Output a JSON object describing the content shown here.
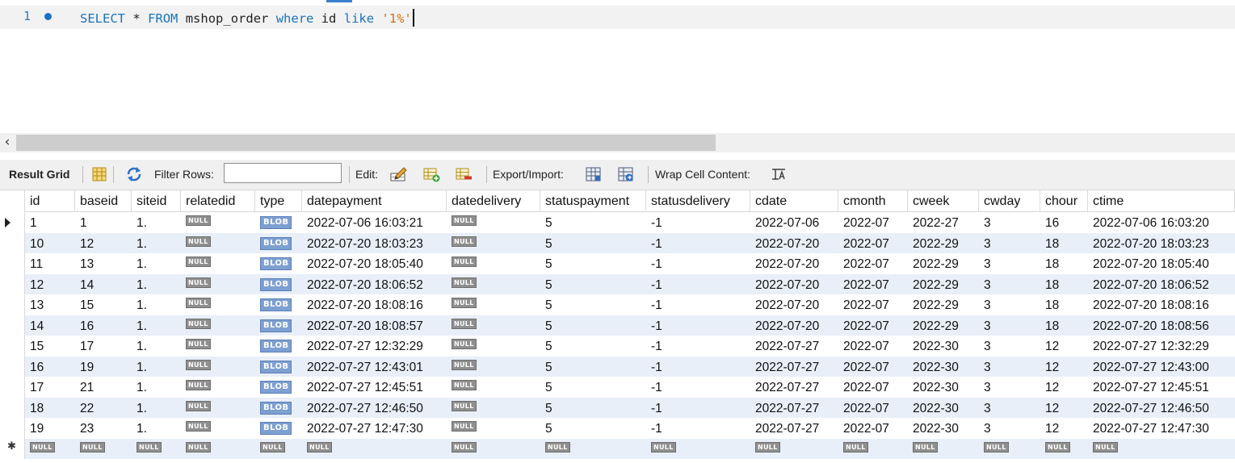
{
  "editor": {
    "line_number": "1",
    "sql": {
      "kw_select": "SELECT",
      "star": "*",
      "kw_from": "FROM",
      "table": "mshop_order",
      "kw_where": "where",
      "column": "id",
      "kw_like": "like",
      "literal": "'1%'"
    }
  },
  "toolbar": {
    "result_grid": "Result Grid",
    "filter_rows": "Filter Rows:",
    "filter_value": "",
    "edit": "Edit:",
    "export_import": "Export/Import:",
    "wrap_cell": "Wrap Cell Content:",
    "icons": [
      "grid-layout-icon",
      "refresh-icon",
      "edit-row-icon",
      "add-row-icon",
      "delete-row-icon",
      "export-icon",
      "import-icon",
      "wrap-text-icon"
    ]
  },
  "grid": {
    "columns": [
      "id",
      "baseid",
      "siteid",
      "relatedid",
      "type",
      "datepayment",
      "datedelivery",
      "statuspayment",
      "statusdelivery",
      "cdate",
      "cmonth",
      "cweek",
      "cwday",
      "chour",
      "ctime"
    ],
    "rows": [
      [
        "1",
        "1",
        "1.",
        "NULL",
        "BLOB",
        "2022-07-06 16:03:21",
        "NULL",
        "5",
        "-1",
        "2022-07-06",
        "2022-07",
        "2022-27",
        "3",
        "16",
        "2022-07-06 16:03:20"
      ],
      [
        "10",
        "12",
        "1.",
        "NULL",
        "BLOB",
        "2022-07-20 18:03:23",
        "NULL",
        "5",
        "-1",
        "2022-07-20",
        "2022-07",
        "2022-29",
        "3",
        "18",
        "2022-07-20 18:03:23"
      ],
      [
        "11",
        "13",
        "1.",
        "NULL",
        "BLOB",
        "2022-07-20 18:05:40",
        "NULL",
        "5",
        "-1",
        "2022-07-20",
        "2022-07",
        "2022-29",
        "3",
        "18",
        "2022-07-20 18:05:40"
      ],
      [
        "12",
        "14",
        "1.",
        "NULL",
        "BLOB",
        "2022-07-20 18:06:52",
        "NULL",
        "5",
        "-1",
        "2022-07-20",
        "2022-07",
        "2022-29",
        "3",
        "18",
        "2022-07-20 18:06:52"
      ],
      [
        "13",
        "15",
        "1.",
        "NULL",
        "BLOB",
        "2022-07-20 18:08:16",
        "NULL",
        "5",
        "-1",
        "2022-07-20",
        "2022-07",
        "2022-29",
        "3",
        "18",
        "2022-07-20 18:08:16"
      ],
      [
        "14",
        "16",
        "1.",
        "NULL",
        "BLOB",
        "2022-07-20 18:08:57",
        "NULL",
        "5",
        "-1",
        "2022-07-20",
        "2022-07",
        "2022-29",
        "3",
        "18",
        "2022-07-20 18:08:56"
      ],
      [
        "15",
        "17",
        "1.",
        "NULL",
        "BLOB",
        "2022-07-27 12:32:29",
        "NULL",
        "5",
        "-1",
        "2022-07-27",
        "2022-07",
        "2022-30",
        "3",
        "12",
        "2022-07-27 12:32:29"
      ],
      [
        "16",
        "19",
        "1.",
        "NULL",
        "BLOB",
        "2022-07-27 12:43:01",
        "NULL",
        "5",
        "-1",
        "2022-07-27",
        "2022-07",
        "2022-30",
        "3",
        "12",
        "2022-07-27 12:43:00"
      ],
      [
        "17",
        "21",
        "1.",
        "NULL",
        "BLOB",
        "2022-07-27 12:45:51",
        "NULL",
        "5",
        "-1",
        "2022-07-27",
        "2022-07",
        "2022-30",
        "3",
        "12",
        "2022-07-27 12:45:51"
      ],
      [
        "18",
        "22",
        "1.",
        "NULL",
        "BLOB",
        "2022-07-27 12:46:50",
        "NULL",
        "5",
        "-1",
        "2022-07-27",
        "2022-07",
        "2022-30",
        "3",
        "12",
        "2022-07-27 12:46:50"
      ],
      [
        "19",
        "23",
        "1.",
        "NULL",
        "BLOB",
        "2022-07-27 12:47:30",
        "NULL",
        "5",
        "-1",
        "2022-07-27",
        "2022-07",
        "2022-30",
        "3",
        "12",
        "2022-07-27 12:47:30"
      ]
    ],
    "new_row": [
      "NULL",
      "NULL",
      "NULL",
      "NULL",
      "NULL",
      "NULL",
      "NULL",
      "NULL",
      "NULL",
      "NULL",
      "NULL",
      "NULL",
      "NULL",
      "NULL",
      "NULL"
    ]
  },
  "colors": {
    "keyword": "#1b73bc",
    "string": "#d4720e",
    "row_alt": "#e8eff9",
    "null_badge": "#8f8f8f",
    "blob_badge": "#7d9fd1"
  }
}
